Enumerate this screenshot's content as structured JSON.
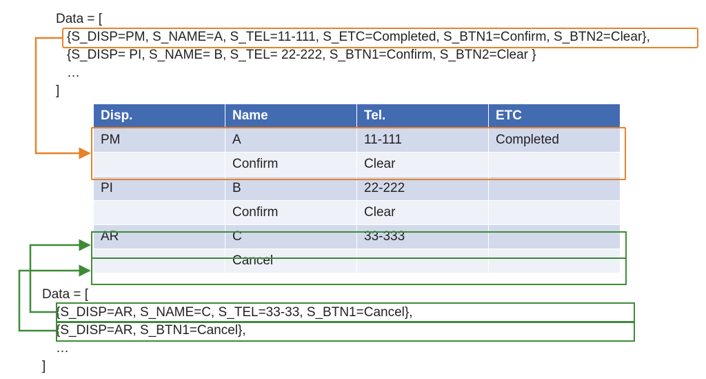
{
  "code_top": {
    "line0": "Data  =  [",
    "line1": "{S_DISP=PM, S_NAME=A, S_TEL=11-111, S_ETC=Completed, S_BTN1=Confirm, S_BTN2=Clear},",
    "line2": "{S_DISP= PI, S_NAME= B, S_TEL= 22-222, S_BTN1=Confirm, S_BTN2=Clear }",
    "line3": "…",
    "line4": "]"
  },
  "code_bottom": {
    "line0": "Data  =  [",
    "line1": "{S_DISP=AR, S_NAME=C, S_TEL=33-33, S_BTN1=Cancel},",
    "line2": "{S_DISP=AR, S_BTN1=Cancel},",
    "line3": "…",
    "line4": "]"
  },
  "table": {
    "headers": {
      "disp": "Disp.",
      "name": "Name",
      "tel": "Tel.",
      "etc": "ETC"
    },
    "rows": [
      {
        "disp": "PM",
        "name": "A",
        "tel": "11-111",
        "etc": "Completed",
        "btn1": "Confirm",
        "btn2": "Clear"
      },
      {
        "disp": "PI",
        "name": "B",
        "tel": "22-222",
        "etc": "",
        "btn1": "Confirm",
        "btn2": "Clear"
      },
      {
        "disp": "AR",
        "name": "C",
        "tel": "33-333",
        "etc": "",
        "btn1": "Cancel",
        "btn2": ""
      }
    ]
  },
  "colors": {
    "orange": "#e8812a",
    "green": "#3d8b37",
    "table_header": "#436bb2"
  }
}
